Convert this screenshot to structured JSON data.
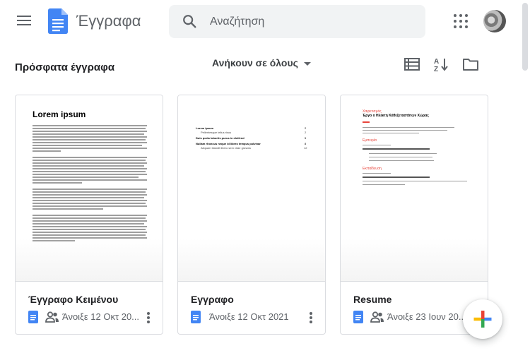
{
  "header": {
    "app_title": "Έγγραφα",
    "search_placeholder": "Αναζήτηση"
  },
  "toolbar": {
    "section_title": "Πρόσφατα έγγραφα",
    "owner_filter": "Ανήκουν σε όλους"
  },
  "cards": [
    {
      "title": "Έγγραφο Κειμένου",
      "opened": "Άνοιξε 12 Οκτ 20...",
      "shared": true,
      "thumb_heading": "Lorem ipsum"
    },
    {
      "title": "Εγγραφο",
      "opened": "Άνοιξε 12 Οκτ 2021",
      "shared": false,
      "toc": [
        {
          "text": "Lorem ipsum",
          "page": "2"
        },
        {
          "text": "Pellentesque tellus risus",
          "page": "2"
        },
        {
          "text": "Duis porta lobortis purus in eleifend",
          "page": "5"
        },
        {
          "text": "Nullam rhoncus neque id libero tempus pulvinar",
          "page": "8"
        },
        {
          "text": "Aliquam blandit libero sem vitae gravida",
          "page": "12"
        }
      ]
    },
    {
      "title": "Resume",
      "opened": "Άνοιξε 23 Ιουν 20...",
      "shared": true,
      "resume": {
        "name_line": "Χαιρετισμός",
        "headline": "Έργο ο Ηλέκτη Κάθεξεταστάτων Χώρας",
        "experience": "Εμπειρία",
        "education": "Εκπαίδευση"
      }
    }
  ],
  "colors": {
    "doc_blue": "#4285f4",
    "accent_red": "#e8453c"
  }
}
